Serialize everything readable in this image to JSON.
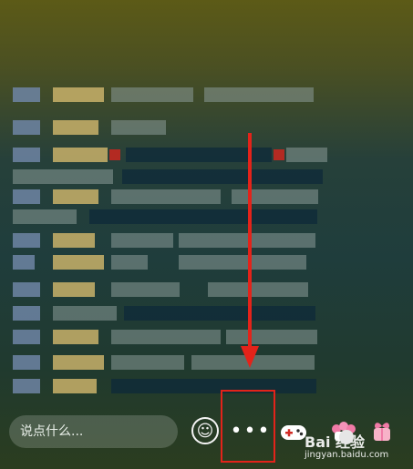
{
  "bottom_bar": {
    "comment_placeholder": "说点什么...",
    "more_label": "•••",
    "smiley_label": "☺"
  },
  "watermark": {
    "text": "Bai  经验",
    "url_text": "jingyan.baidu.com"
  },
  "colors": {
    "annotation_red": "#e3231a",
    "icon_white": "#ffffff"
  },
  "icons": [
    "smiley-icon",
    "more-icon",
    "gamepad-icon",
    "gift-icon",
    "paw-icon"
  ]
}
